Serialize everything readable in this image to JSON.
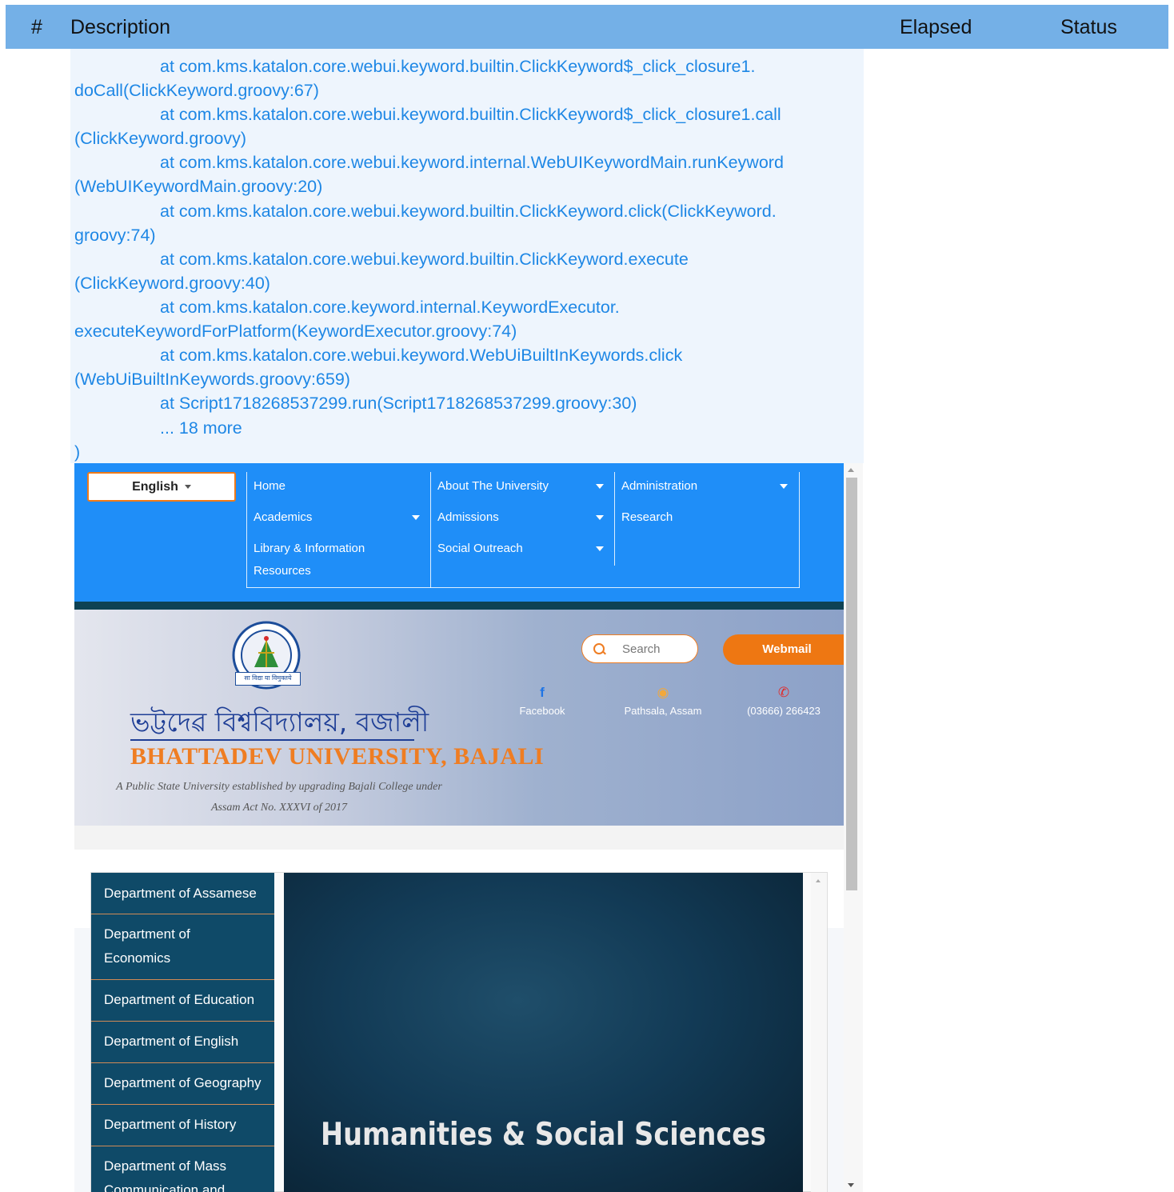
{
  "report_header": {
    "num_label": "#",
    "description_label": "Description",
    "elapsed_label": "Elapsed",
    "status_label": "Status"
  },
  "log_lines": [
    "at com.kms.katalon.core.webui.keyword.builtin.ClickKeyword$_click_closure1.",
    "doCall(ClickKeyword.groovy:67)",
    "at com.kms.katalon.core.webui.keyword.builtin.ClickKeyword$_click_closure1.call",
    "(ClickKeyword.groovy)",
    "at com.kms.katalon.core.webui.keyword.internal.WebUIKeywordMain.runKeyword",
    "(WebUIKeywordMain.groovy:20)",
    "at com.kms.katalon.core.webui.keyword.builtin.ClickKeyword.click(ClickKeyword.",
    "groovy:74)",
    "at com.kms.katalon.core.webui.keyword.builtin.ClickKeyword.execute",
    "(ClickKeyword.groovy:40)",
    "at com.kms.katalon.core.keyword.internal.KeywordExecutor.",
    "executeKeywordForPlatform(KeywordExecutor.groovy:74)",
    "at com.kms.katalon.core.webui.keyword.WebUiBuiltInKeywords.click",
    "(WebUiBuiltInKeywords.groovy:659)",
    "at Script1718268537299.run(Script1718268537299.groovy:30)",
    "... 18 more",
    ")"
  ],
  "site": {
    "language": "English",
    "menu": {
      "home": "Home",
      "about": "About The University",
      "administration": "Administration",
      "academics": "Academics",
      "admissions": "Admissions",
      "research": "Research",
      "library_1": "Library & Information",
      "library_2": "Resources",
      "social_outreach": "Social Outreach"
    },
    "logo_caption": "सा विद्या या विमुक्तये",
    "university_name_assamese": "ভট্টদেৱ বিশ্ববিদ্যালয়, বজালী",
    "university_name_english": "BHATTADEV UNIVERSITY, BAJALI",
    "tagline_1": "A Public State University established by upgrading Bajali College under",
    "tagline_2": "Assam Act No. XXXVI of 2017",
    "search_placeholder": "Search",
    "webmail_label": "Webmail",
    "contacts": {
      "facebook": "Facebook",
      "location": "Pathsala, Assam",
      "phone": "(03666) 266423"
    },
    "departments": [
      "Department of Assamese",
      "Department of",
      "Economics",
      "Department of Education",
      "Department of English",
      "Department of Geography",
      "Department of History",
      "Department of Mass",
      "Communication and"
    ],
    "hero_title": "Humanities & Social Sciences"
  },
  "colors": {
    "report_header_bg": "#74b0e7",
    "log_text": "#1e87e5",
    "nav_bg": "#1f8ef8",
    "accent_orange": "#ee7712",
    "dept_bg": "#0f4a68"
  }
}
